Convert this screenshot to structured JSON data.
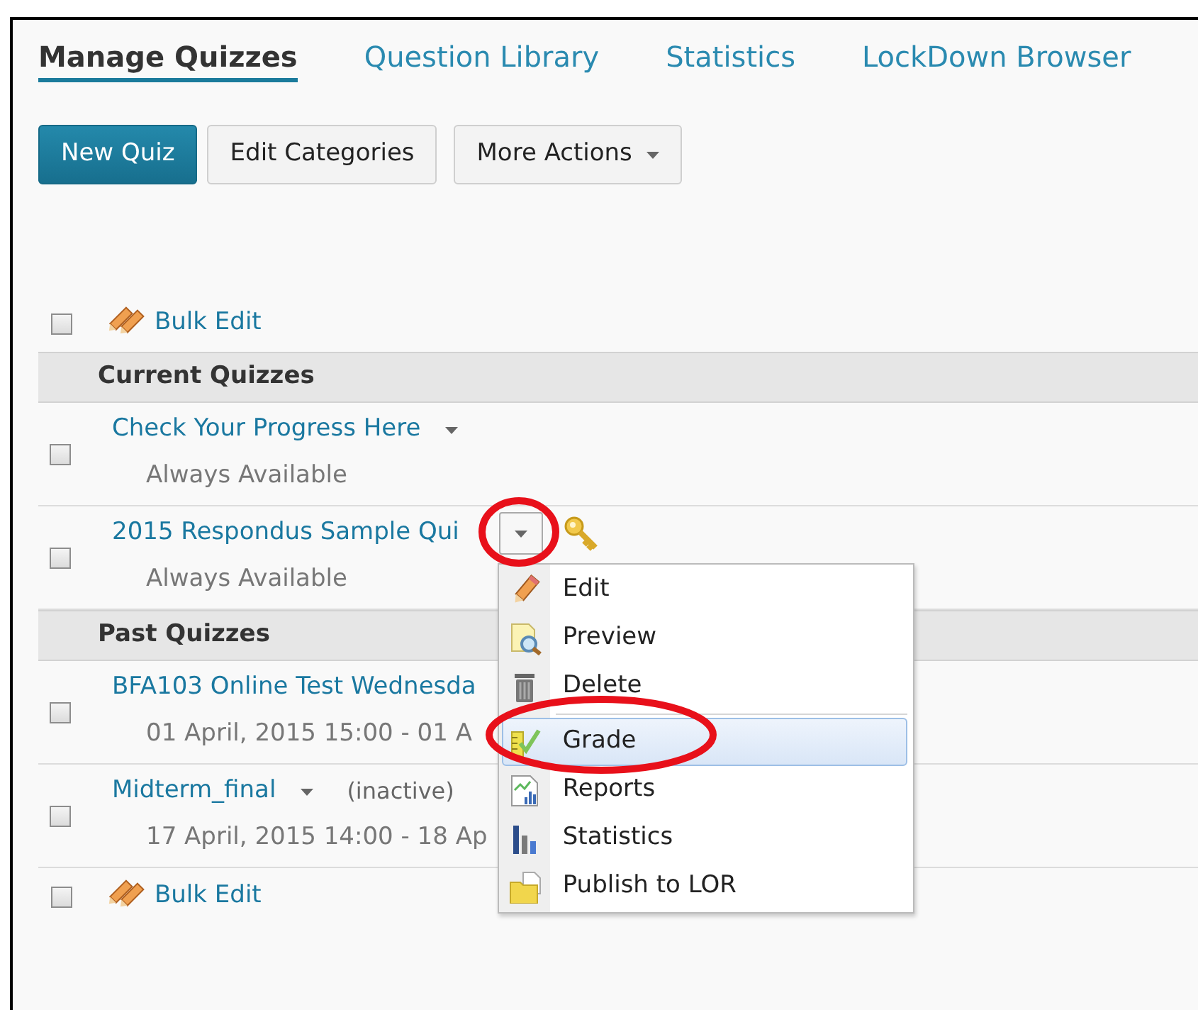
{
  "tabs": [
    {
      "label": "Manage Quizzes",
      "selected": true
    },
    {
      "label": "Question Library",
      "selected": false
    },
    {
      "label": "Statistics",
      "selected": false
    },
    {
      "label": "LockDown Browser",
      "selected": false
    }
  ],
  "toolbar": [
    {
      "label": "New Quiz",
      "kind": "primary"
    },
    {
      "label": "Edit Categories",
      "kind": "plain"
    },
    {
      "label": "More Actions",
      "kind": "menu"
    }
  ],
  "bulk_edit_top": {
    "label": "Bulk Edit",
    "checked": false
  },
  "sections": [
    {
      "title": "Current Quizzes",
      "quizzes": [
        {
          "title": "Check Your Progress Here",
          "availability": "Always Available",
          "checked": false,
          "menu_open": false
        },
        {
          "title": "2015 Respondus Sample Qui",
          "availability": "Always Available",
          "checked": false,
          "menu_open": true,
          "has_key": true,
          "circled": true
        }
      ]
    },
    {
      "title": "Past Quizzes",
      "quizzes": [
        {
          "title": "BFA103 Online Test Wednesda",
          "availability": "01 April, 2015 15:00 - 01 A",
          "checked": false
        },
        {
          "title": "Midterm_final",
          "status": "(inactive)",
          "availability": "17 April, 2015 14:00 - 18 Ap",
          "checked": false,
          "menu_open": false
        }
      ]
    }
  ],
  "bulk_edit_bottom": {
    "label": "Bulk Edit",
    "checked": false
  },
  "context_menu": {
    "items": [
      {
        "kind": "action",
        "label": "Edit",
        "selected": false
      },
      {
        "kind": "action",
        "label": "Preview",
        "selected": false
      },
      {
        "kind": "action",
        "label": "Delete",
        "selected": false
      },
      {
        "kind": "separator"
      },
      {
        "kind": "action",
        "label": "Grade",
        "selected": true,
        "circled": true
      },
      {
        "kind": "action",
        "label": "Reports",
        "selected": false
      },
      {
        "kind": "action",
        "label": "Statistics",
        "selected": false
      },
      {
        "kind": "action",
        "label": "Publish to LOR",
        "selected": false
      }
    ]
  }
}
